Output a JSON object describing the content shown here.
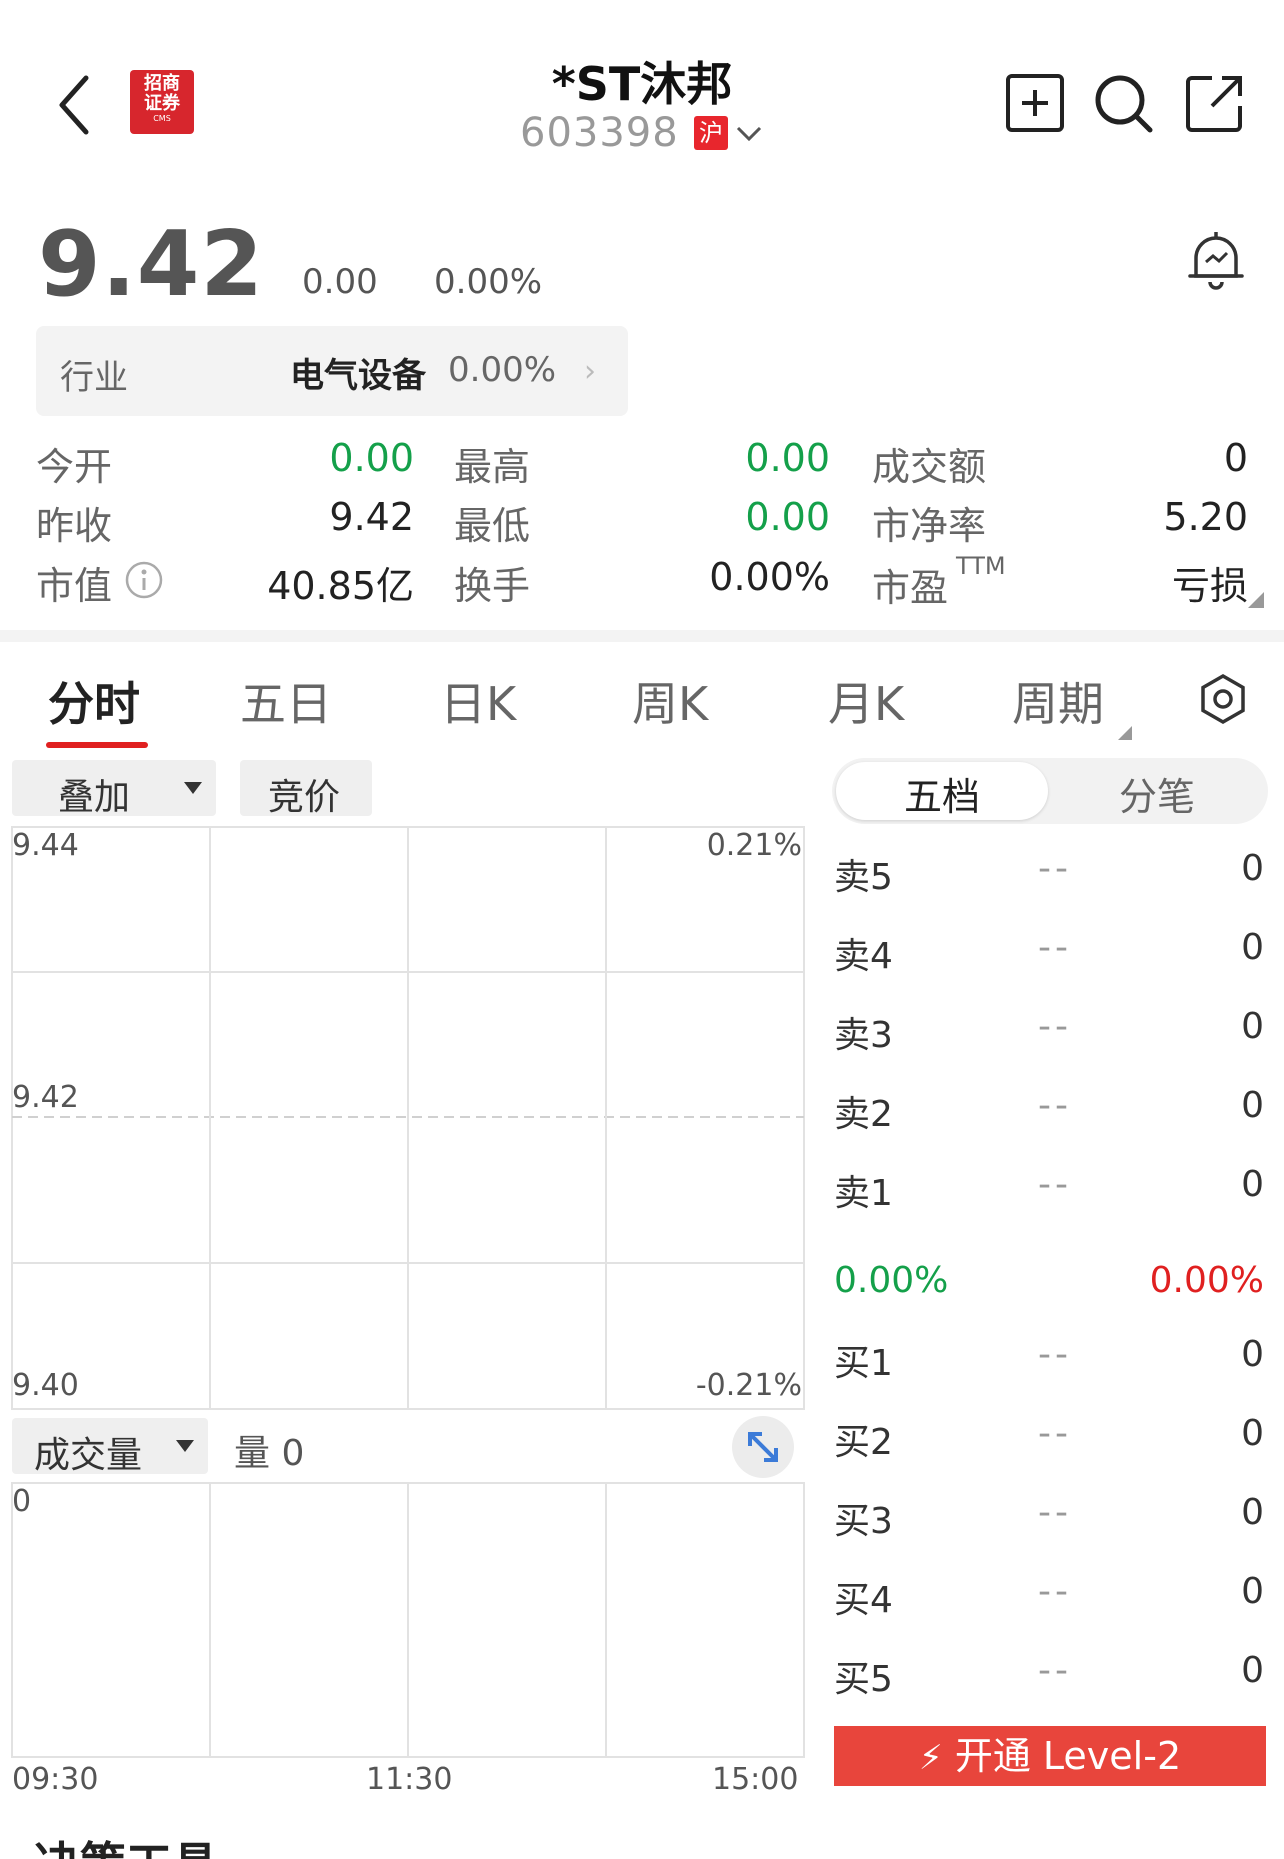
{
  "header": {
    "title": "*ST沐邦",
    "code": "603398",
    "market_badge": "沪",
    "logo_text_line1": "招商",
    "logo_text_line2": "证券",
    "logo_text_line3": "CMS"
  },
  "quote": {
    "price": "9.42",
    "change": "0.00",
    "change_pct": "0.00%"
  },
  "industry": {
    "label": "行业",
    "name": "电气设备",
    "pct": "0.00%"
  },
  "stats": [
    {
      "label": "今开",
      "value": "0.00",
      "color": "#14a04a"
    },
    {
      "label": "最高",
      "value": "0.00",
      "color": "#14a04a"
    },
    {
      "label": "成交额",
      "value": "0",
      "color": "#222222"
    },
    {
      "label": "昨收",
      "value": "9.42",
      "color": "#222222"
    },
    {
      "label": "最低",
      "value": "0.00",
      "color": "#14a04a"
    },
    {
      "label": "市净率",
      "value": "5.20",
      "color": "#222222"
    },
    {
      "label": "市值",
      "value": "40.85亿",
      "color": "#222222"
    },
    {
      "label": "换手",
      "value": "0.00%",
      "color": "#222222"
    },
    {
      "label": "市盈",
      "label_sup": "TTM",
      "value": "亏损",
      "color": "#222222"
    }
  ],
  "tabs": [
    "分时",
    "五日",
    "日K",
    "周K",
    "月K",
    "周期"
  ],
  "chart_controls": {
    "overlay": "叠加",
    "auction": "竞价",
    "volume_select": "成交量",
    "volume_readout": "量 0"
  },
  "chart_data": {
    "type": "line",
    "title": "",
    "y_left_ticks": [
      "9.44",
      "9.42",
      "9.40"
    ],
    "y_right_ticks": [
      "0.21%",
      "-0.21%"
    ],
    "x_ticks": [
      "09:30",
      "11:30",
      "15:00"
    ],
    "ylim": [
      9.4,
      9.44
    ],
    "prev_close": 9.42,
    "series": [],
    "volume_ylabel": "0"
  },
  "order_book": {
    "tabs": [
      "五档",
      "分笔"
    ],
    "sells": [
      {
        "label": "卖5",
        "price": "--",
        "vol": "0"
      },
      {
        "label": "卖4",
        "price": "--",
        "vol": "0"
      },
      {
        "label": "卖3",
        "price": "--",
        "vol": "0"
      },
      {
        "label": "卖2",
        "price": "--",
        "vol": "0"
      },
      {
        "label": "卖1",
        "price": "--",
        "vol": "0"
      }
    ],
    "ratio_left": "0.00%",
    "ratio_right": "0.00%",
    "buys": [
      {
        "label": "买1",
        "price": "--",
        "vol": "0"
      },
      {
        "label": "买2",
        "price": "--",
        "vol": "0"
      },
      {
        "label": "买3",
        "price": "--",
        "vol": "0"
      },
      {
        "label": "买4",
        "price": "--",
        "vol": "0"
      },
      {
        "label": "买5",
        "price": "--",
        "vol": "0"
      }
    ],
    "level2_button": "开通 Level-2"
  },
  "footer": {
    "section_title": "决策工具"
  }
}
